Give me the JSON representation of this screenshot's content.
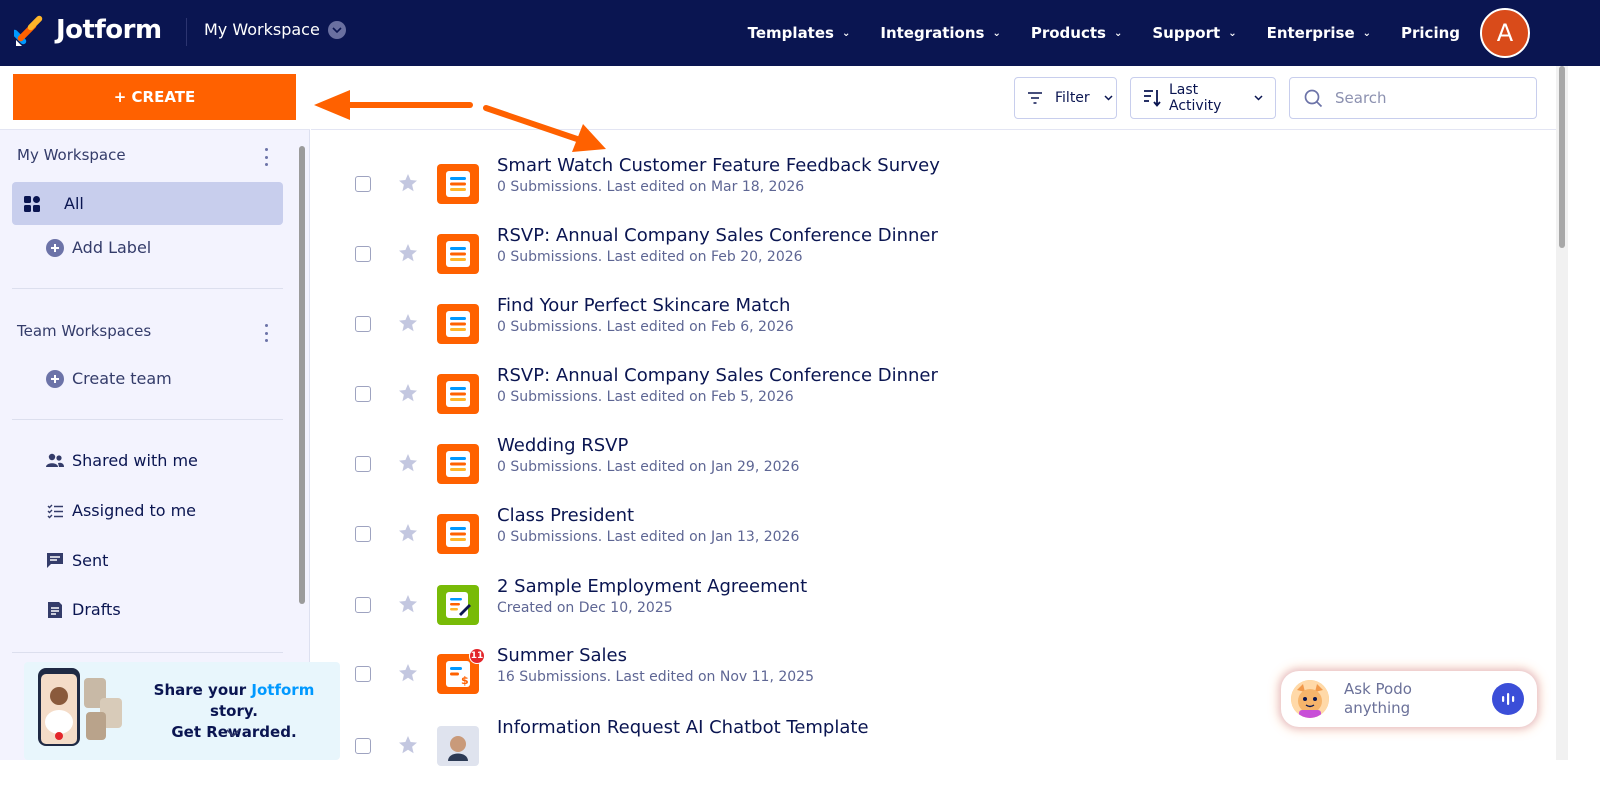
{
  "app": {
    "brand": "Jotform",
    "workspace_switch": "My Workspace",
    "avatar_initial": "A",
    "brand_color": "#0a1551",
    "accent_color": "#ff6100"
  },
  "nav": {
    "items": [
      "Templates",
      "Integrations",
      "Products",
      "Support",
      "Enterprise"
    ],
    "pricing": "Pricing"
  },
  "sidebar": {
    "create_label": "+ CREATE",
    "my_workspace_title": "My Workspace",
    "all_label": "All",
    "add_label": "Add Label",
    "team_title": "Team Workspaces",
    "create_team": "Create team",
    "shared": "Shared with me",
    "assigned": "Assigned to me",
    "sent": "Sent",
    "drafts": "Drafts"
  },
  "promo": {
    "line1_prefix": "Share your ",
    "line1_brand": "Jotform",
    "line1_suffix": " story.",
    "line2": "Get Rewarded."
  },
  "toolbar": {
    "filter_label": "Filter",
    "sort_label": "Last Activity",
    "search_placeholder": "Search"
  },
  "forms": [
    {
      "title": "Smart Watch Customer Feature Feedback Survey",
      "subtitle": "0 Submissions. Last edited on Mar 18, 2026",
      "icon": "form-icon"
    },
    {
      "title": "RSVP: Annual Company Sales Conference Dinner",
      "subtitle": "0 Submissions. Last edited on Feb 20, 2026",
      "icon": "form-icon"
    },
    {
      "title": "Find Your Perfect Skincare Match",
      "subtitle": "0 Submissions. Last edited on Feb 6, 2026",
      "icon": "form-icon"
    },
    {
      "title": "RSVP: Annual Company Sales Conference Dinner",
      "subtitle": "0 Submissions. Last edited on Feb 5, 2026",
      "icon": "form-icon"
    },
    {
      "title": "Wedding RSVP",
      "subtitle": "0 Submissions. Last edited on Jan 29, 2026",
      "icon": "form-icon"
    },
    {
      "title": "Class President",
      "subtitle": "0 Submissions. Last edited on Jan 13, 2026",
      "icon": "form-icon"
    },
    {
      "title": "2 Sample Employment Agreement",
      "subtitle": "Created on Dec 10, 2025",
      "icon": "sign-document-icon"
    },
    {
      "title": "Summer Sales",
      "subtitle": "16 Submissions. Last edited on Nov 11, 2025",
      "icon": "payment-form-icon",
      "badge": "11"
    },
    {
      "title": "Information Request AI Chatbot Template",
      "subtitle": "",
      "icon": "agent-avatar-icon"
    }
  ],
  "podo": {
    "label": "Ask Podo anything"
  }
}
